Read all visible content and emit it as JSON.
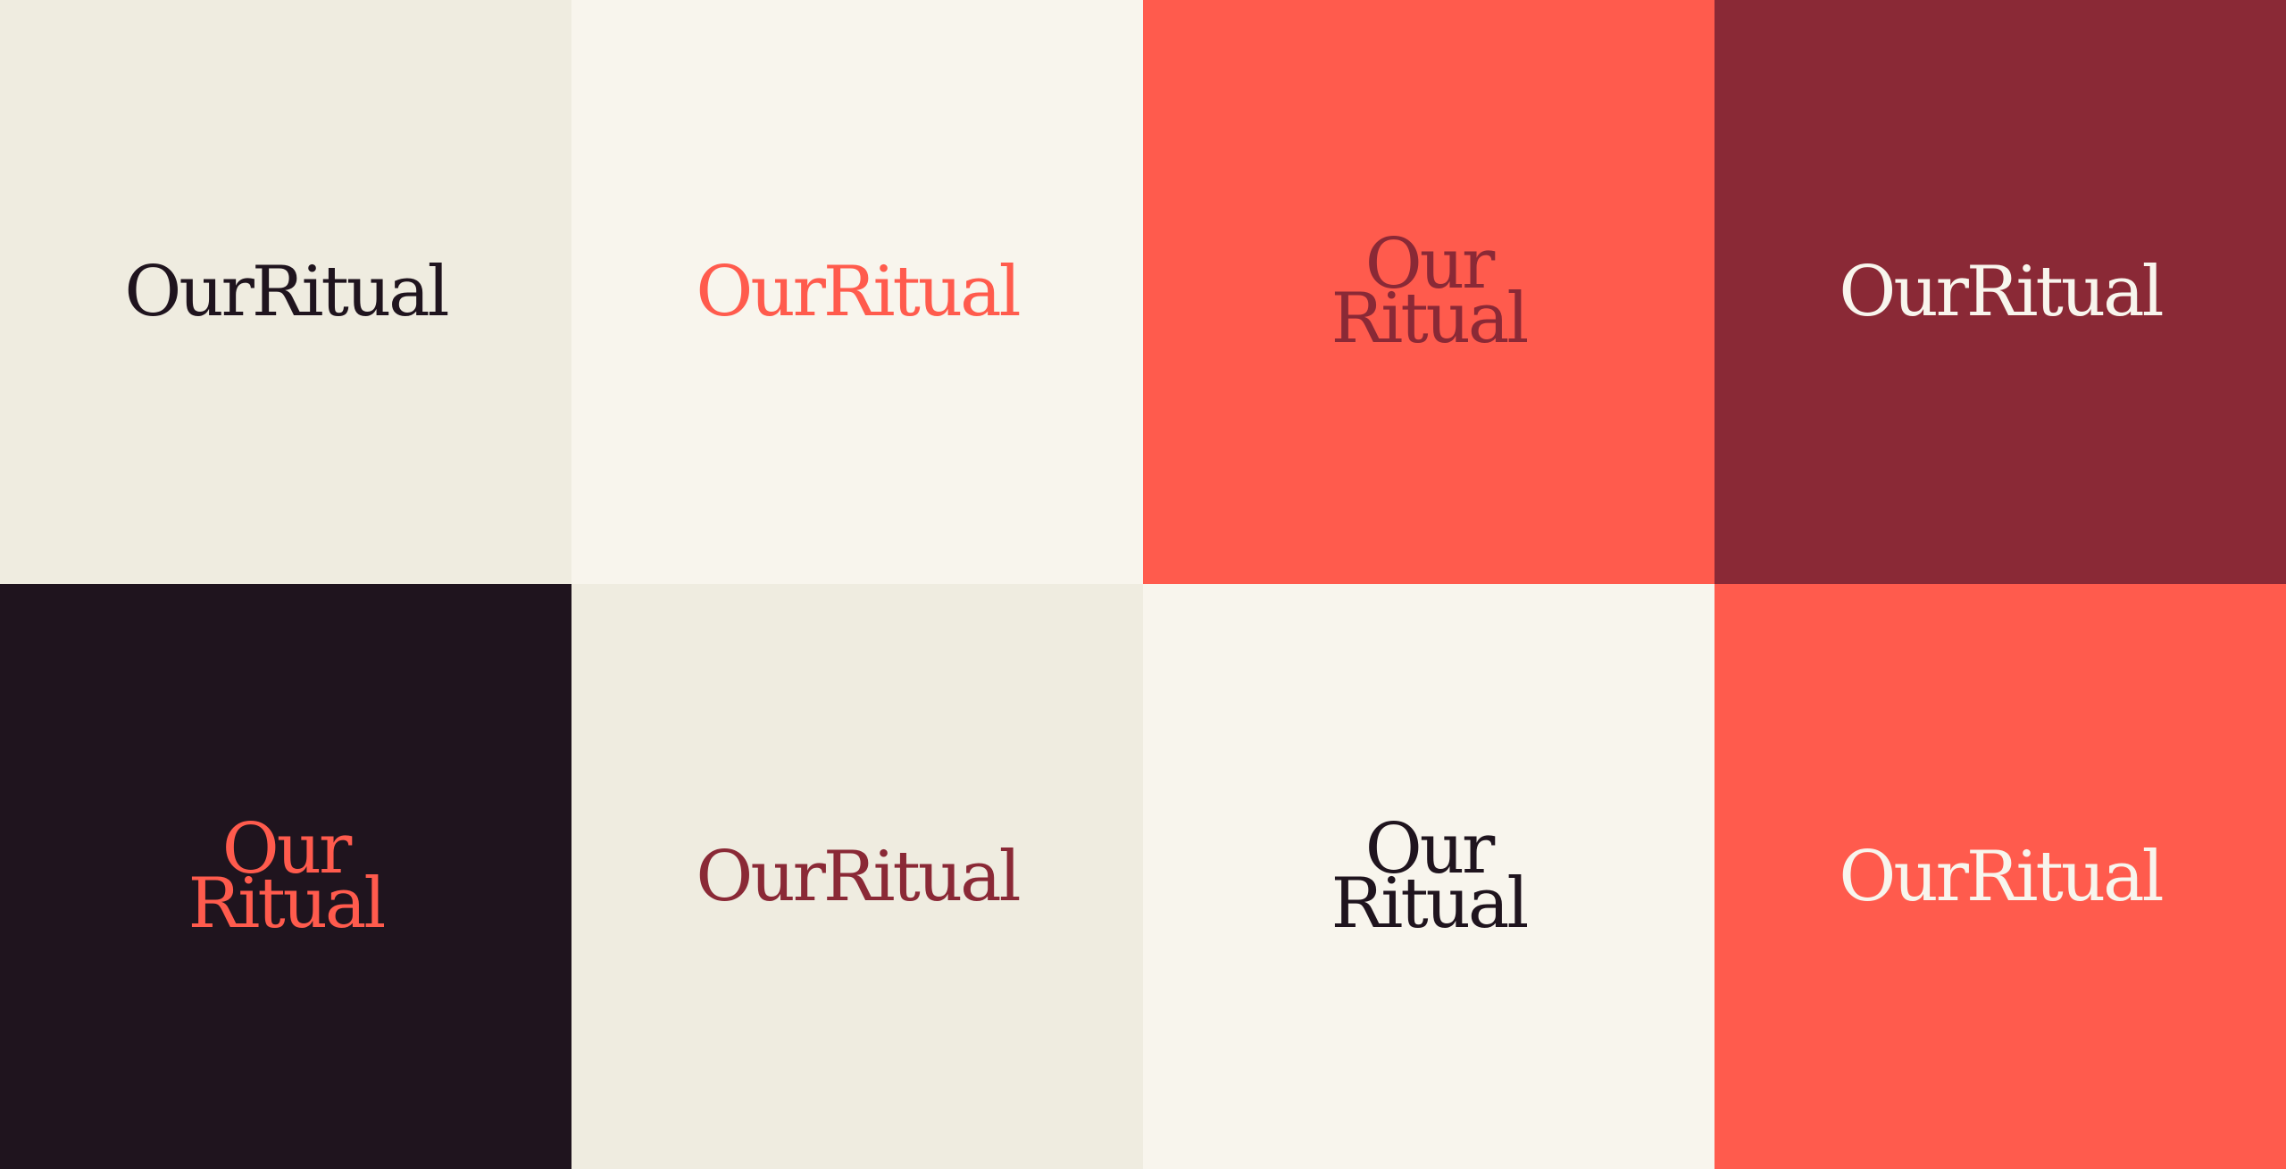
{
  "tiles": [
    {
      "background": "#EFECE0",
      "color": "#1F141E",
      "layout": "inline",
      "word1": "Our",
      "word2": "Ritual"
    },
    {
      "background": "#F8F5ED",
      "color": "#FF5B4D",
      "layout": "inline",
      "word1": "Our",
      "word2": "Ritual"
    },
    {
      "background": "#FF5B4D",
      "color": "#8A2936",
      "layout": "stacked",
      "word1": "Our",
      "word2": "Ritual"
    },
    {
      "background": "#8A2936",
      "color": "#F8F5ED",
      "layout": "inline",
      "word1": "Our",
      "word2": "Ritual"
    },
    {
      "background": "#1F141E",
      "color": "#FF5B4D",
      "layout": "stacked",
      "word1": "Our",
      "word2": "Ritual"
    },
    {
      "background": "#EFECE0",
      "color": "#8A2936",
      "layout": "inline",
      "word1": "Our",
      "word2": "Ritual"
    },
    {
      "background": "#F8F5ED",
      "color": "#1F141E",
      "layout": "stacked",
      "word1": "Our",
      "word2": "Ritual"
    },
    {
      "background": "#FF5B4D",
      "color": "#F8F5ED",
      "layout": "inline",
      "word1": "Our",
      "word2": "Ritual"
    }
  ]
}
